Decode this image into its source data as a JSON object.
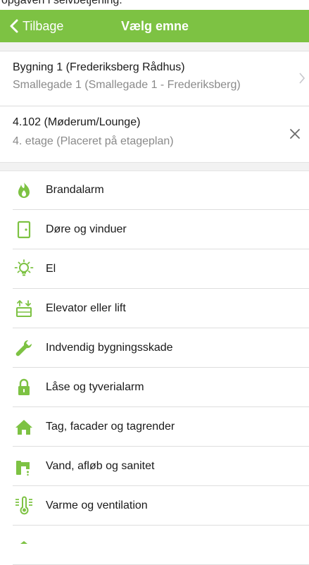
{
  "header_cut": "opgaven i selvbetjening.",
  "nav": {
    "back_label": "Tilbage",
    "title": "Vælg emne"
  },
  "building": {
    "name": "Bygning 1 (Frederiksberg Rådhus)",
    "address": "Smallegade 1 (Smallegade 1 - Frederiksberg)"
  },
  "room": {
    "name": "4.102  (Møderum/Lounge)",
    "floor": "4. etage (Placeret på etageplan)"
  },
  "topics": [
    {
      "label": "Brandalarm",
      "icon": "flame-icon"
    },
    {
      "label": "Døre og vinduer",
      "icon": "door-icon"
    },
    {
      "label": "El",
      "icon": "lightbulb-icon"
    },
    {
      "label": "Elevator eller lift",
      "icon": "elevator-icon"
    },
    {
      "label": "Indvendig bygningsskade",
      "icon": "wrench-icon"
    },
    {
      "label": "Låse og tyverialarm",
      "icon": "lock-icon"
    },
    {
      "label": "Tag, facader og tagrender",
      "icon": "house-icon"
    },
    {
      "label": "Vand, afløb og sanitet",
      "icon": "faucet-icon"
    },
    {
      "label": "Varme og ventilation",
      "icon": "thermometer-icon"
    }
  ],
  "colors": {
    "accent": "#7dc243",
    "separator": "#dedede",
    "secondary_text": "#8a8a8a"
  }
}
